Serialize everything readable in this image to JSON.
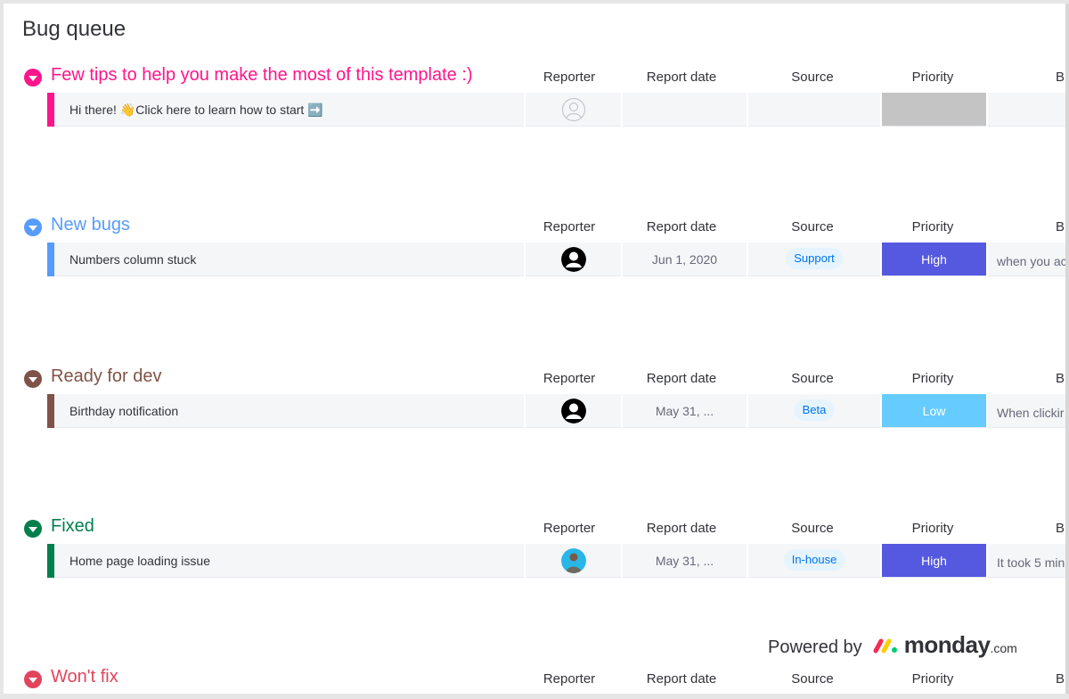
{
  "board": {
    "title": "Bug queue"
  },
  "columns": {
    "reporter": "Reporter",
    "report_date": "Report date",
    "source": "Source",
    "priority": "Priority",
    "next": "B"
  },
  "groups": [
    {
      "title": "Few tips to help you make the most of this template :)",
      "color": "#ff158a",
      "items": [
        {
          "name": "Hi there! 👋Click here to learn how to start ➡️",
          "reporter": "empty-avatar",
          "report_date": "",
          "source": "",
          "priority": "",
          "priority_color": "#c4c4c4",
          "next_col": ""
        }
      ]
    },
    {
      "title": "New bugs",
      "color": "#579bfc",
      "items": [
        {
          "name": "Numbers column stuck",
          "reporter": "user-avatar",
          "report_date": "Jun 1, 2020",
          "source": "Support",
          "priority": "High",
          "priority_color": "#5559df",
          "next_col": "when you ac"
        }
      ]
    },
    {
      "title": "Ready for dev",
      "color": "#7f5347",
      "items": [
        {
          "name": "Birthday notification",
          "reporter": "user-avatar",
          "report_date": "May 31, ...",
          "source": "Beta",
          "priority": "Low",
          "priority_color": "#66ccff",
          "next_col": "When clickir"
        }
      ]
    },
    {
      "title": "Fixed",
      "color": "#037f4c",
      "items": [
        {
          "name": "Home page loading issue",
          "reporter": "photo-avatar",
          "report_date": "May 31, ...",
          "source": "In-house",
          "priority": "High",
          "priority_color": "#5559df",
          "next_col": "It took 5 min"
        }
      ]
    },
    {
      "title": "Won't fix",
      "color": "#e2445c",
      "items": []
    }
  ],
  "footer": {
    "powered_by": "Powered by",
    "brand": "monday",
    "brand_suffix": ".com"
  }
}
